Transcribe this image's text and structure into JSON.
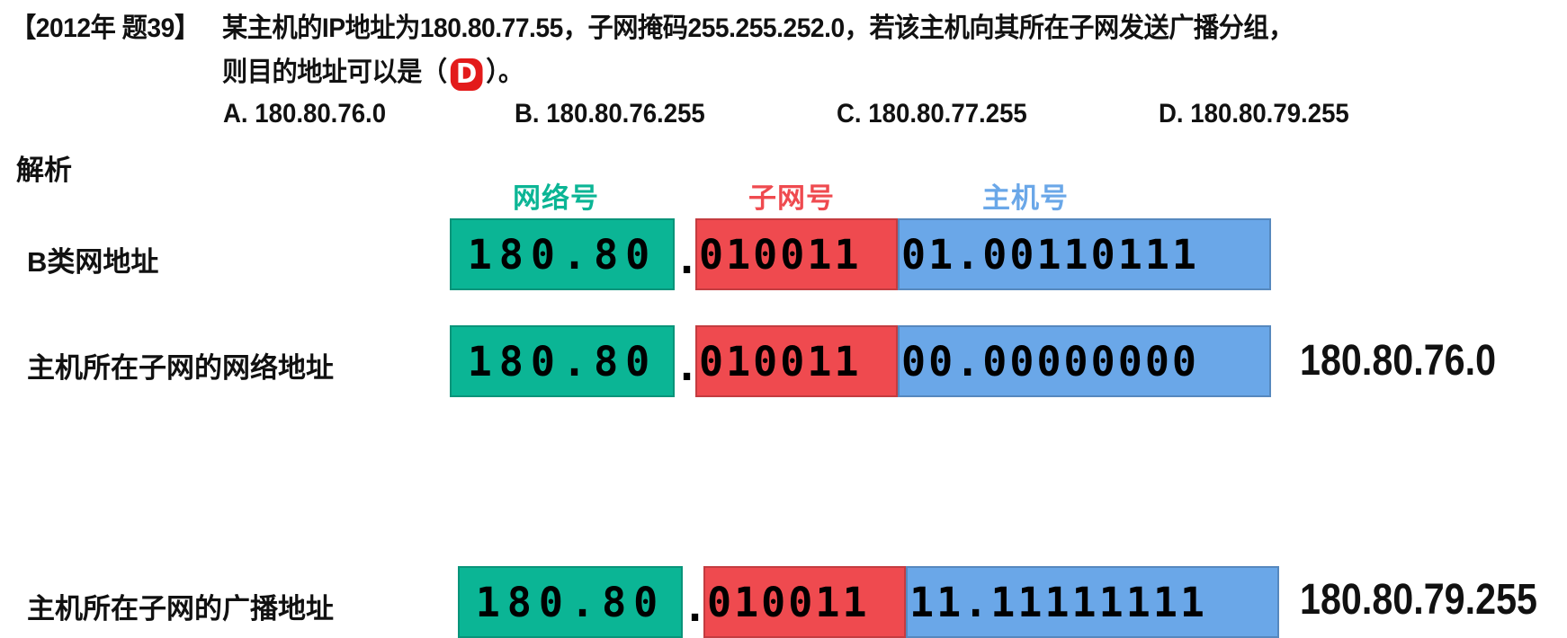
{
  "question": {
    "tag": "【2012年 题39】",
    "line1": "某主机的IP地址为180.80.77.55，子网掩码255.255.252.0，若该主机向其所在子网发送广播分组，",
    "line2_prefix": "则目的地址可以是（",
    "answer": "D",
    "line2_suffix": "）。",
    "options": [
      "A. 180.80.76.0",
      "B. 180.80.76.255",
      "C. 180.80.77.255",
      "D. 180.80.79.255"
    ]
  },
  "analysis_title": "解析",
  "legend": {
    "network": "网络号",
    "subnet": "子网号",
    "host": "主机号"
  },
  "colors": {
    "network": "#0bb595",
    "subnet": "#ef4a4f",
    "host": "#6aa7e8",
    "answer": "#e31b1b"
  },
  "rows": [
    {
      "label": "B类网地址",
      "network": "180.80",
      "dot": ".",
      "subnet": "010011",
      "host": "01.00110111",
      "result": ""
    },
    {
      "label": "主机所在子网的网络地址",
      "network": "180.80",
      "dot": ".",
      "subnet": "010011",
      "host": "00.00000000",
      "result": "180.80.76.0"
    },
    {
      "label": "主机所在子网的广播地址",
      "network": "180.80",
      "dot": ".",
      "subnet": "010011",
      "host": "11.11111111",
      "result": "180.80.79.255"
    }
  ]
}
